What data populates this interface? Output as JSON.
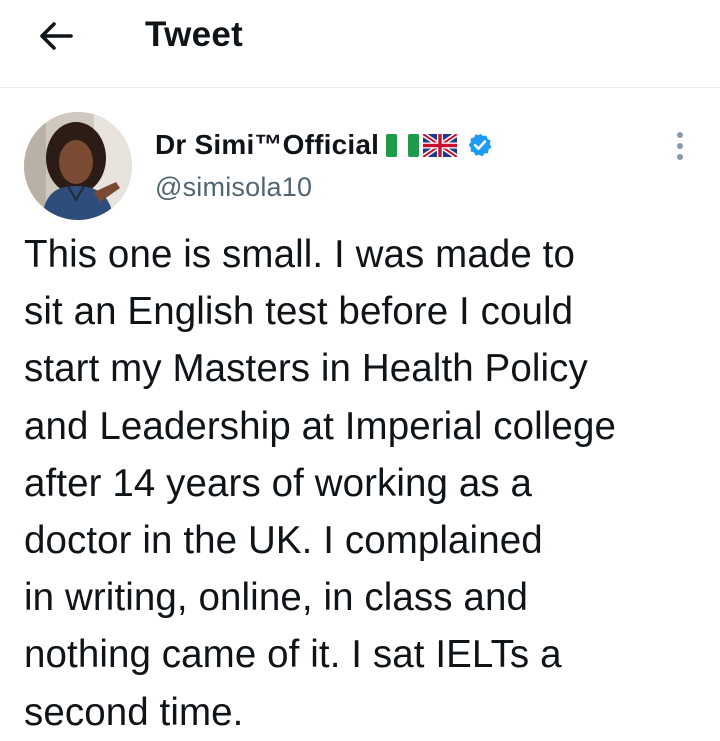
{
  "header": {
    "title": "Tweet",
    "back_icon": "arrow-left-icon"
  },
  "author": {
    "display_name": "Dr Simi™Official",
    "flags": [
      "nigeria-flag",
      "uk-flag"
    ],
    "verified": true,
    "handle": "@simisola10"
  },
  "tweet": {
    "lines": [
      "This one is small. I was made to",
      "sit an English test before I could",
      "start my Masters in Health Policy",
      "and Leadership at Imperial college",
      "after 14 years of working as a",
      "doctor in the UK. I complained",
      "in writing, online, in class and",
      "nothing came of it. I sat IELTs a",
      "second time."
    ]
  },
  "colors": {
    "text": "#0f1419",
    "secondary": "#536471",
    "verified_blue": "#1d9bf0",
    "divider": "#e6e9ec"
  }
}
